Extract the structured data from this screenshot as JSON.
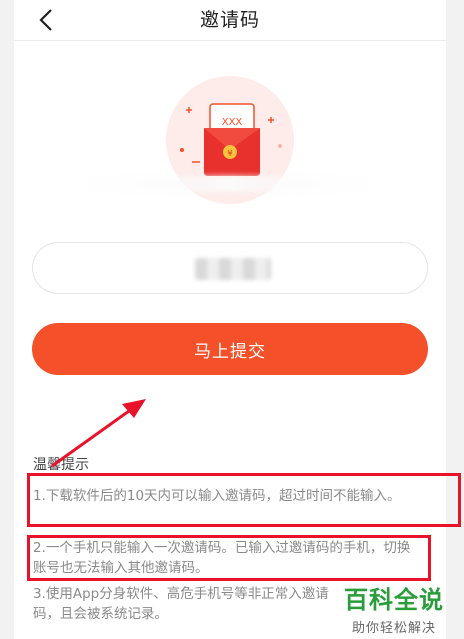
{
  "header": {
    "title": "邀请码"
  },
  "illustration": {
    "envelope_text": "XXX",
    "accent_color": "#f4512b"
  },
  "form": {
    "submit_label": "马上提交"
  },
  "tips": {
    "title": "温馨提示",
    "items": [
      "1.下载软件后的10天内可以输入邀请码，超过时间不能输入。",
      "2.一个手机只能输入一次邀请码。已输入过邀请码的手机，切换账号也无法输入其他邀请码。",
      "3.使用App分身软件、高危手机号等非正常入邀请码，且会被系统记录。"
    ]
  },
  "watermark": {
    "main": "百科全说",
    "sub": "助你轻松解决"
  },
  "icons": {
    "back": "chevron-left-icon",
    "envelope": "red-envelope-icon"
  }
}
